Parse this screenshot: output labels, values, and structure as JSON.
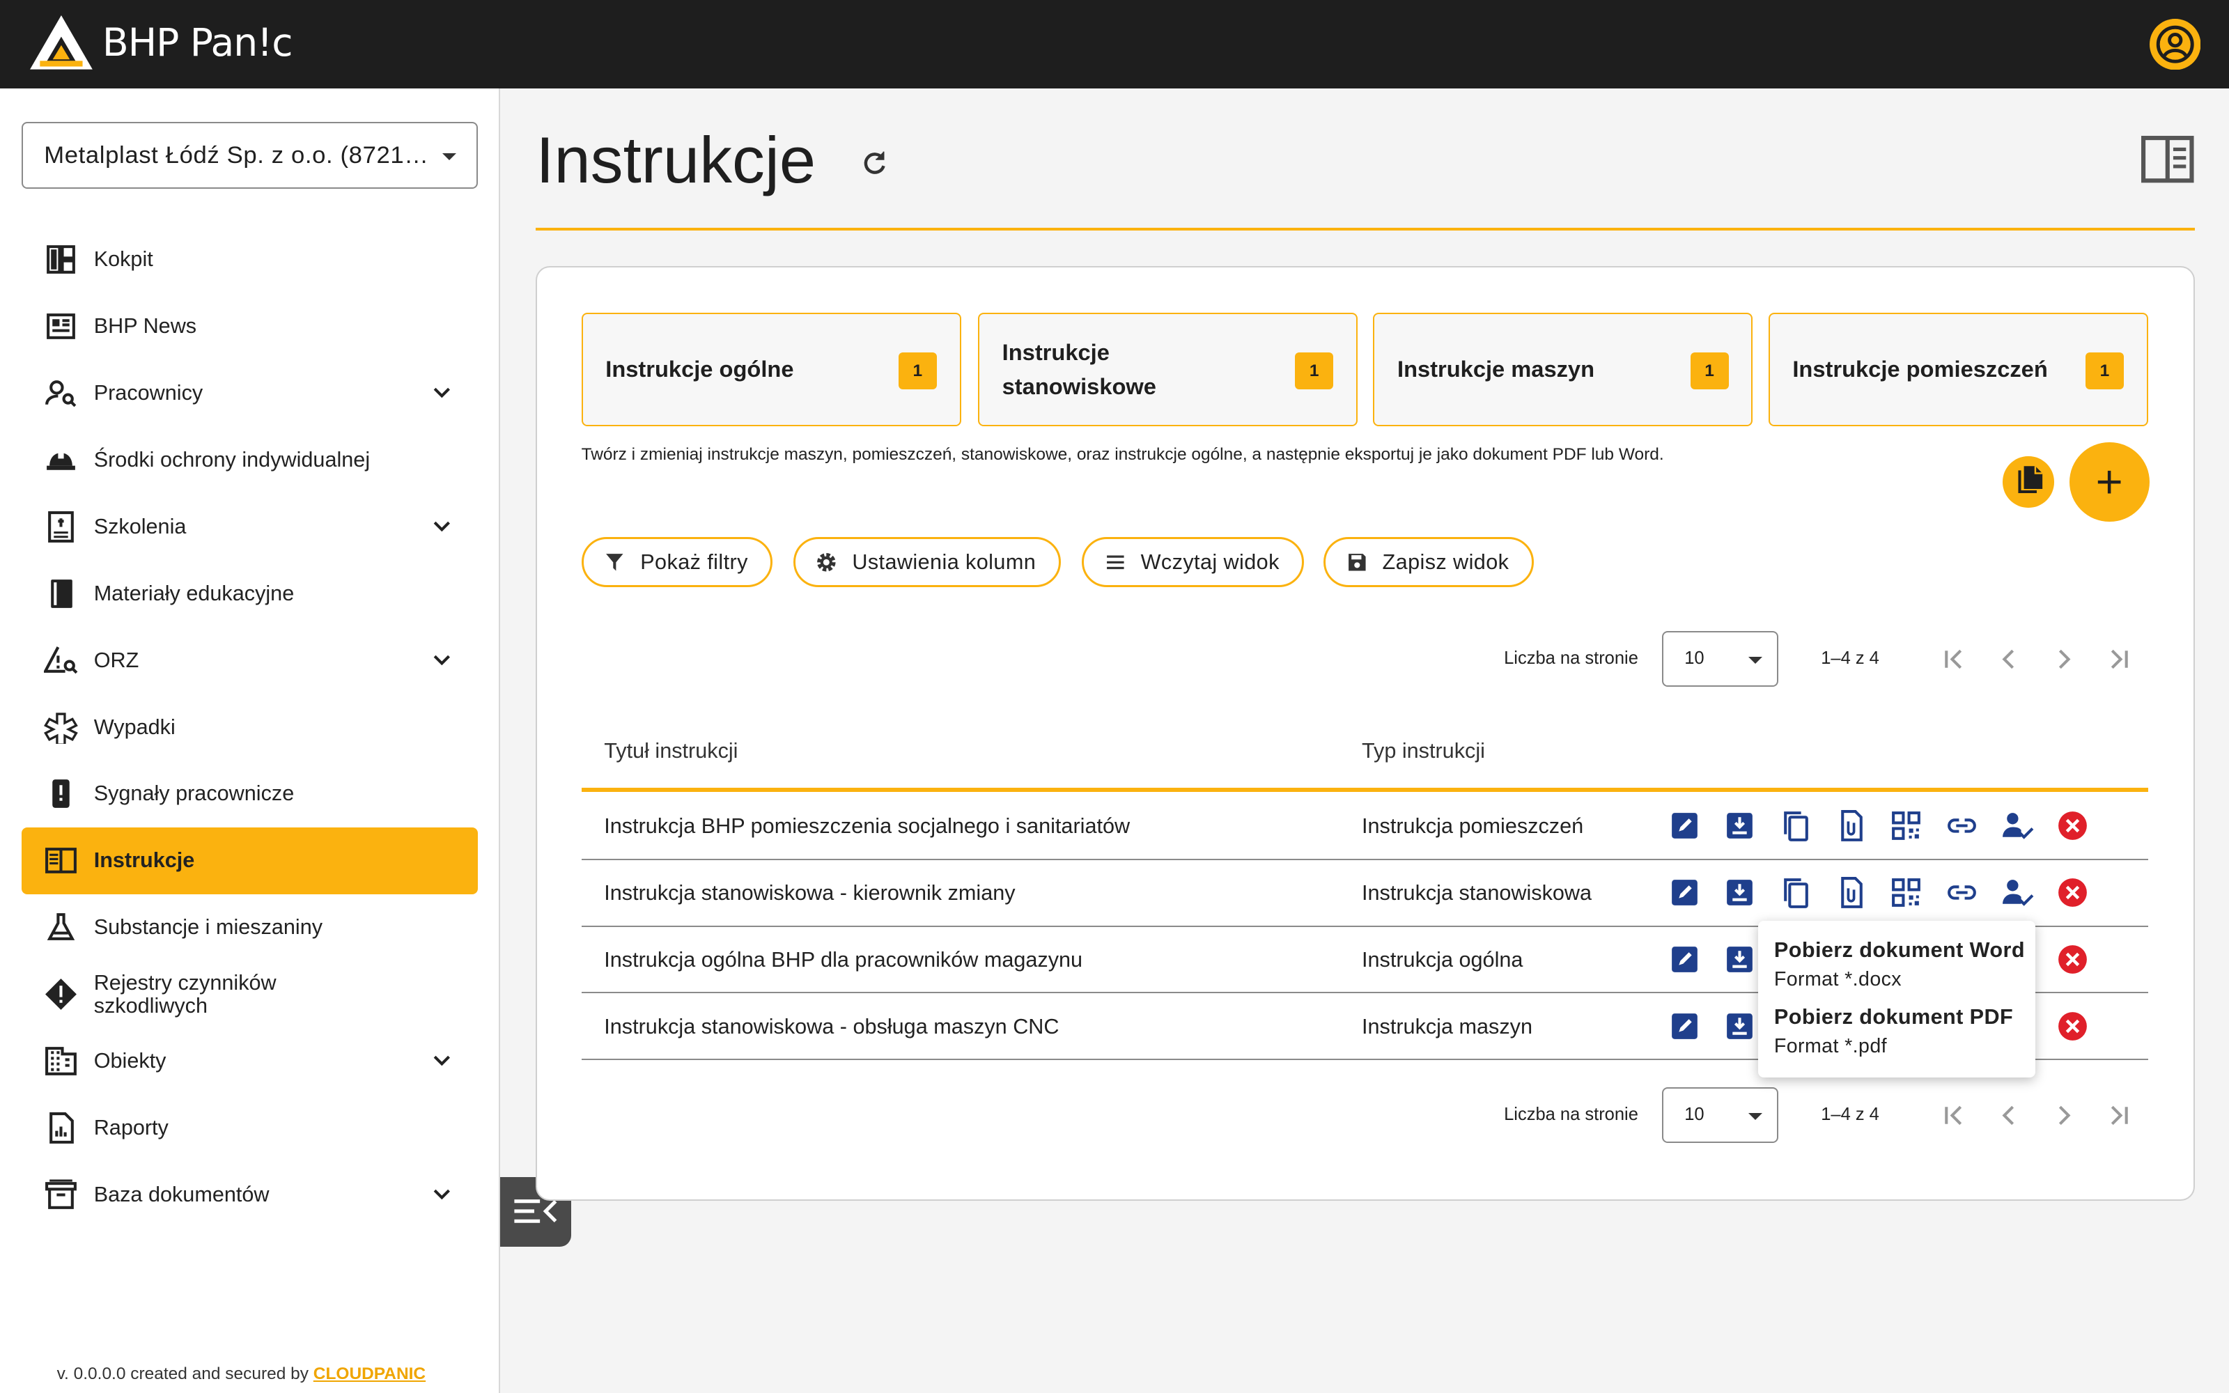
{
  "header": {
    "brand": "BHP Pan!c"
  },
  "company_select": {
    "value": "Metalplast Łódź Sp. z o.o. (8721…"
  },
  "sidebar": {
    "items": [
      {
        "label": "Kokpit",
        "icon": "dashboard-icon"
      },
      {
        "label": "BHP News",
        "icon": "newspaper-icon"
      },
      {
        "label": "Pracownicy",
        "icon": "person-search-icon"
      },
      {
        "label": "Środki ochrony indywidualnej",
        "icon": "hard-hat-icon"
      },
      {
        "label": "Szkolenia",
        "icon": "training-book-icon"
      },
      {
        "label": "Materiały edukacyjne",
        "icon": "book-icon"
      },
      {
        "label": "ORZ",
        "icon": "risk-triangle-icon"
      },
      {
        "label": "Wypadki",
        "icon": "medical-star-icon"
      },
      {
        "label": "Sygnały pracownicze",
        "icon": "alert-device-icon"
      },
      {
        "label": "Instrukcje",
        "icon": "instructions-book-icon"
      },
      {
        "label": "Substancje i mieszaniny",
        "icon": "flask-icon"
      },
      {
        "label": "Rejestry czynników szkodliwych",
        "icon": "warning-diamond-icon"
      },
      {
        "label": "Obiekty",
        "icon": "building-icon"
      },
      {
        "label": "Raporty",
        "icon": "report-icon"
      },
      {
        "label": "Baza dokumentów",
        "icon": "archive-icon"
      }
    ],
    "footer_text": "v. 0.0.0.0 created and secured by ",
    "footer_link": "CLOUDPANIC"
  },
  "page": {
    "title": "Instrukcje"
  },
  "tiles": [
    {
      "label": "Instrukcje ogólne",
      "count": "1"
    },
    {
      "label": "Instrukcje stanowiskowe",
      "count": "1"
    },
    {
      "label": "Instrukcje maszyn",
      "count": "1"
    },
    {
      "label": "Instrukcje pomieszczeń",
      "count": "1"
    }
  ],
  "description": "Twórz i zmieniaj instrukcje maszyn, pomieszczeń, stanowiskowe, oraz instrukcje ogólne, a następnie eksportuj je jako dokument PDF lub Word.",
  "toolbar": {
    "show_filters": "Pokaż filtry",
    "column_settings": "Ustawienia kolumn",
    "load_view": "Wczytaj widok",
    "save_view": "Zapisz widok"
  },
  "pagination": {
    "label": "Liczba na stronie",
    "page_size": "10",
    "range": "1–4 z 4"
  },
  "table": {
    "headers": [
      "Tytuł instrukcji",
      "Typ instrukcji"
    ],
    "rows": [
      {
        "title": "Instrukcja BHP pomieszczenia socjalnego i sanitariatów",
        "type": "Instrukcja pomieszczeń"
      },
      {
        "title": "Instrukcja stanowiskowa - kierownik zmiany",
        "type": "Instrukcja stanowiskowa"
      },
      {
        "title": "Instrukcja ogólna BHP dla pracowników magazynu",
        "type": "Instrukcja ogólna"
      },
      {
        "title": "Instrukcja stanowiskowa - obsługa maszyn CNC",
        "type": "Instrukcja maszyn"
      }
    ]
  },
  "tooltip": {
    "word_title": "Pobierz dokument Word",
    "word_format": "Format *.docx",
    "pdf_title": "Pobierz dokument PDF",
    "pdf_format": "Format *.pdf"
  },
  "colors": {
    "accent": "#fbb20f",
    "topbar": "#1e1e1e",
    "action_blue": "#1f3f8c",
    "delete_red": "#e0202a"
  }
}
